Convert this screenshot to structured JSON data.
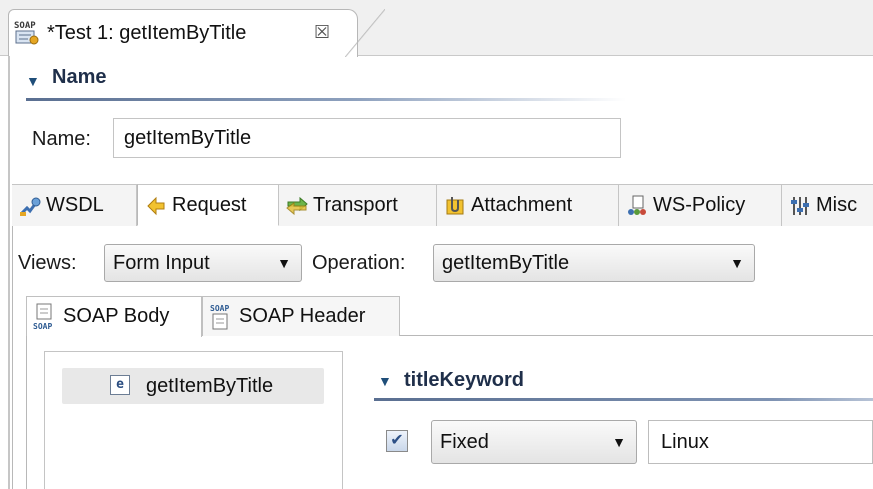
{
  "editor_tab": {
    "title": "*Test 1: getItemByTitle",
    "close_glyph": "☒",
    "icon": "soap-icon"
  },
  "name_section": {
    "header": "Name",
    "name_label": "Name:",
    "name_value": "getItemByTitle"
  },
  "main_tabs": [
    {
      "label": "WSDL",
      "icon": "wsdl-icon",
      "active": false
    },
    {
      "label": "Request",
      "icon": "request-icon",
      "active": true
    },
    {
      "label": "Transport",
      "icon": "transport-icon",
      "active": false
    },
    {
      "label": "Attachment",
      "icon": "attachment-icon",
      "active": false
    },
    {
      "label": "WS-Policy",
      "icon": "ws-policy-icon",
      "active": false
    },
    {
      "label": "Misc",
      "icon": "misc-icon",
      "active": false
    }
  ],
  "request": {
    "views_label": "Views:",
    "views_value": "Form Input",
    "operation_label": "Operation:",
    "operation_value": "getItemByTitle"
  },
  "sub_tabs": [
    {
      "label": "SOAP Body",
      "icon": "soap-body-icon",
      "active": true
    },
    {
      "label": "SOAP Header",
      "icon": "soap-header-icon",
      "active": false
    }
  ],
  "tree": {
    "item_icon_letter": "e",
    "item_label": "getItemByTitle"
  },
  "title_keyword": {
    "header": "titleKeyword",
    "checked": true,
    "mode_value": "Fixed",
    "value": "Linux"
  },
  "colors": {
    "section_header_text": "#1f2f4a",
    "section_rule": "#5a6f91",
    "tab_active_bg": "#ffffff",
    "tab_inactive_bg": "#f4f4f4"
  }
}
